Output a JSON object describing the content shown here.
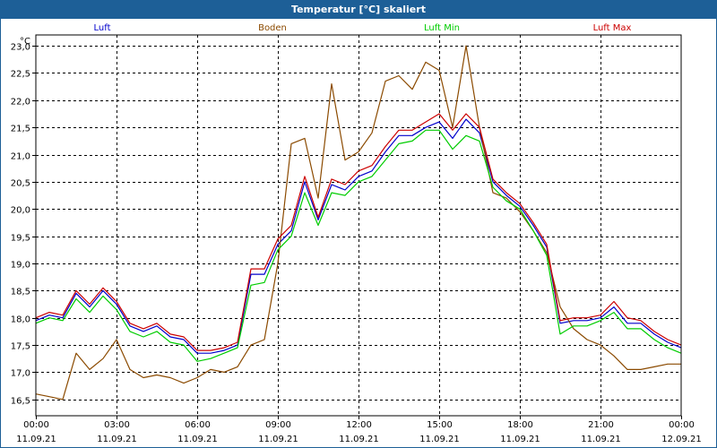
{
  "window": {
    "title": "Temperatur [°C] skaliert"
  },
  "chart_data": {
    "type": "line",
    "title": "Temperatur [°C] skaliert",
    "ylabel": "°C",
    "xlabel": "",
    "ylim": [
      16.2,
      23.2
    ],
    "xlim": [
      0,
      24
    ],
    "y_ticks": [
      16.5,
      17.0,
      17.5,
      18.0,
      18.5,
      19.0,
      19.5,
      20.0,
      20.5,
      21.0,
      21.5,
      22.0,
      22.5,
      23.0
    ],
    "y_tick_labels": [
      "16,5",
      "17,0",
      "17,5",
      "18,0",
      "18,5",
      "19,0",
      "19,5",
      "20,0",
      "20,5",
      "21,0",
      "21,5",
      "22,0",
      "22,5",
      "23,0"
    ],
    "x_ticks": [
      0,
      3,
      6,
      9,
      12,
      15,
      18,
      21,
      24
    ],
    "x_tick_labels": [
      {
        "time": "00:00",
        "date": "11.09.21"
      },
      {
        "time": "03:00",
        "date": "11.09.21"
      },
      {
        "time": "06:00",
        "date": "11.09.21"
      },
      {
        "time": "09:00",
        "date": "11.09.21"
      },
      {
        "time": "12:00",
        "date": "11.09.21"
      },
      {
        "time": "15:00",
        "date": "11.09.21"
      },
      {
        "time": "18:00",
        "date": "11.09.21"
      },
      {
        "time": "21:00",
        "date": "11.09.21"
      },
      {
        "time": "00:00",
        "date": "12.09.21"
      }
    ],
    "grid": true,
    "legend_position": "top",
    "x_hours": [
      0,
      0.5,
      1,
      1.5,
      2,
      2.5,
      3,
      3.5,
      4,
      4.5,
      5,
      5.5,
      6,
      6.5,
      7,
      7.5,
      8,
      8.5,
      9,
      9.5,
      10,
      10.5,
      11,
      11.5,
      12,
      12.5,
      13,
      13.5,
      14,
      14.5,
      15,
      15.5,
      16,
      16.5,
      17,
      17.5,
      18,
      18.5,
      19,
      19.5,
      20,
      20.5,
      21,
      21.5,
      22,
      22.5,
      23,
      23.5,
      24
    ],
    "series": [
      {
        "name": "Luft",
        "color": "#0000cc",
        "values": [
          17.95,
          18.05,
          18.0,
          18.45,
          18.2,
          18.5,
          18.25,
          17.85,
          17.75,
          17.85,
          17.65,
          17.6,
          17.35,
          17.35,
          17.4,
          17.5,
          18.8,
          18.8,
          19.35,
          19.6,
          20.5,
          19.8,
          20.45,
          20.35,
          20.6,
          20.7,
          21.05,
          21.35,
          21.35,
          21.5,
          21.6,
          21.3,
          21.65,
          21.4,
          20.5,
          20.25,
          20.05,
          19.7,
          19.3,
          17.9,
          17.95,
          17.95,
          18.0,
          18.2,
          17.9,
          17.9,
          17.7,
          17.55,
          17.45
        ]
      },
      {
        "name": "Boden",
        "color": "#8b4a00",
        "values": [
          16.6,
          16.55,
          16.5,
          17.35,
          17.05,
          17.25,
          17.6,
          17.05,
          16.9,
          16.95,
          16.9,
          16.8,
          16.9,
          17.05,
          17.0,
          17.1,
          17.5,
          17.6,
          19.0,
          21.2,
          21.3,
          20.2,
          22.3,
          20.9,
          21.05,
          21.4,
          22.35,
          22.45,
          22.2,
          22.7,
          22.55,
          21.5,
          23.0,
          21.5,
          20.3,
          20.2,
          19.95,
          19.6,
          19.2,
          18.2,
          17.8,
          17.6,
          17.5,
          17.3,
          17.05,
          17.05,
          17.1,
          17.15,
          17.15
        ]
      },
      {
        "name": "Luft Min",
        "color": "#00cc00",
        "values": [
          17.9,
          18.0,
          17.95,
          18.35,
          18.1,
          18.4,
          18.15,
          17.75,
          17.65,
          17.75,
          17.55,
          17.5,
          17.2,
          17.25,
          17.35,
          17.45,
          18.6,
          18.65,
          19.25,
          19.5,
          20.3,
          19.7,
          20.3,
          20.25,
          20.5,
          20.6,
          20.9,
          21.2,
          21.25,
          21.45,
          21.45,
          21.1,
          21.35,
          21.25,
          20.4,
          20.15,
          20.0,
          19.6,
          19.15,
          17.7,
          17.85,
          17.85,
          17.95,
          18.1,
          17.8,
          17.8,
          17.6,
          17.45,
          17.35
        ]
      },
      {
        "name": "Luft Max",
        "color": "#cc0000",
        "values": [
          18.0,
          18.1,
          18.05,
          18.5,
          18.25,
          18.55,
          18.3,
          17.9,
          17.8,
          17.9,
          17.7,
          17.65,
          17.4,
          17.4,
          17.45,
          17.55,
          18.9,
          18.9,
          19.45,
          19.7,
          20.6,
          19.85,
          20.55,
          20.45,
          20.7,
          20.8,
          21.15,
          21.45,
          21.45,
          21.6,
          21.75,
          21.45,
          21.75,
          21.5,
          20.55,
          20.3,
          20.1,
          19.75,
          19.35,
          17.95,
          18.0,
          18.0,
          18.05,
          18.3,
          18.0,
          17.95,
          17.75,
          17.6,
          17.5
        ]
      }
    ]
  }
}
